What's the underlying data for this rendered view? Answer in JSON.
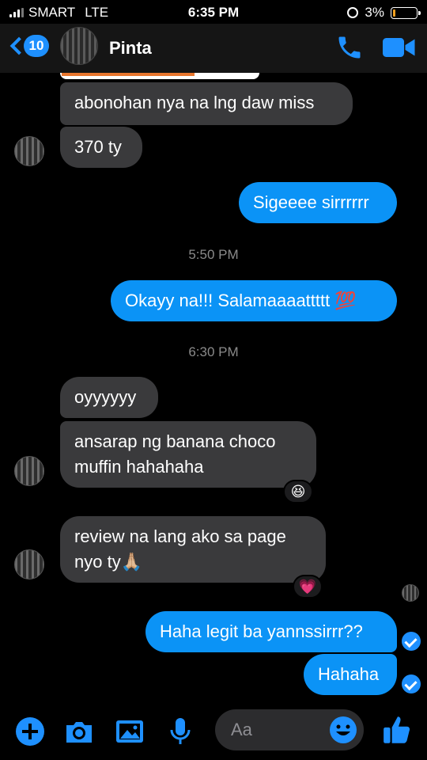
{
  "status_bar": {
    "carrier": "SMART",
    "network": "LTE",
    "time": "6:35 PM",
    "battery": "3%"
  },
  "header": {
    "unread_count": "10",
    "contact_name": "Pinta"
  },
  "messages": [
    {
      "direction": "incoming",
      "text": "abonohan nya na lng daw miss"
    },
    {
      "direction": "incoming",
      "text": "370 ty"
    },
    {
      "direction": "outgoing",
      "text": "Sigeeee sirrrrrr"
    },
    {
      "type": "timestamp",
      "text": "5:50 PM"
    },
    {
      "direction": "outgoing",
      "text": "Okayy na!!! Salamaaaattttt 💯"
    },
    {
      "type": "timestamp",
      "text": "6:30 PM"
    },
    {
      "direction": "incoming",
      "text": "oyyyyyy"
    },
    {
      "direction": "incoming",
      "line1": "ansarap ng banana choco",
      "line2": "muffin hahahaha",
      "reaction": "😆"
    },
    {
      "direction": "incoming",
      "line1": "review na lang ako sa page",
      "line2": "nyo ty🙏🏼",
      "reaction": "💗"
    },
    {
      "direction": "outgoing",
      "text": "Haha legit ba yannssirrr??"
    },
    {
      "direction": "outgoing",
      "text": "Hahaha"
    }
  ],
  "composer": {
    "placeholder": "Aa"
  },
  "icons": {
    "back": "chevron-left-icon",
    "call": "phone-icon",
    "video": "video-camera-icon",
    "add": "plus-icon",
    "camera": "camera-icon",
    "gallery": "image-icon",
    "voice": "microphone-icon",
    "emoji": "smiley-icon",
    "like": "thumbs-up-icon"
  },
  "colors": {
    "accent": "#1e90ff",
    "outgoing_bubble": "#0b93f6",
    "incoming_bubble": "#3a3a3c",
    "background": "#000000"
  }
}
